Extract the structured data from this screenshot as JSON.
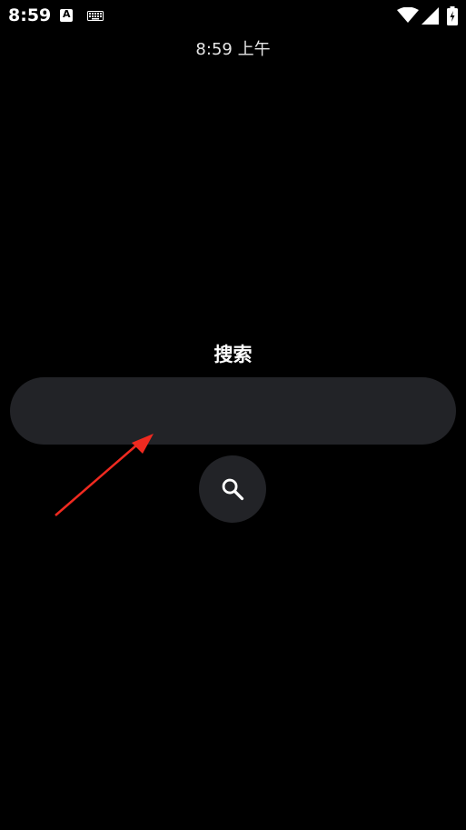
{
  "status_bar": {
    "time": "8:59",
    "notification_icon_letter": "A",
    "icons": [
      "a-notification-icon",
      "keyboard-icon",
      "wifi-icon",
      "signal-icon",
      "battery-icon"
    ]
  },
  "clock": {
    "text": "8:59 上午"
  },
  "search": {
    "title": "搜索",
    "input_value": "",
    "button_icon": "search-icon"
  },
  "colors": {
    "background": "#000000",
    "input_background": "#222327",
    "text": "#ffffff",
    "annotation": "#f02a20"
  }
}
